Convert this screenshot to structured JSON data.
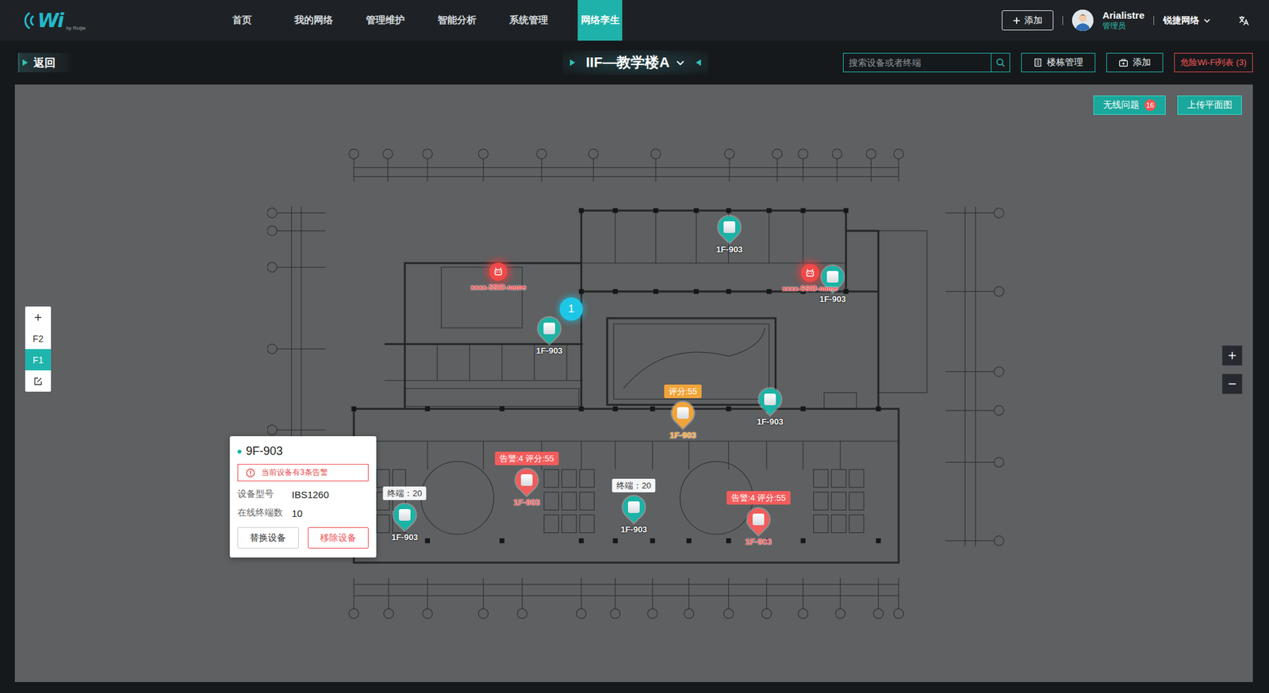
{
  "header": {
    "logo": {
      "mark": "Wi",
      "sub": "by Ruijie"
    },
    "nav": [
      {
        "label": "首页",
        "selected": false
      },
      {
        "label": "我的网络",
        "selected": false
      },
      {
        "label": "管理维护",
        "selected": false
      },
      {
        "label": "智能分析",
        "selected": false
      },
      {
        "label": "系统管理",
        "selected": false
      },
      {
        "label": "网络孪生",
        "selected": true
      }
    ],
    "add_button": {
      "label": "添加"
    },
    "user": {
      "name": "Arialistre",
      "role": "管理员"
    },
    "org": {
      "label": "锐捷网络"
    }
  },
  "toolbar": {
    "back": "返回",
    "building": "IIF—教学楼A",
    "search": {
      "placeholder": "搜索设备或者终端"
    },
    "buttons": [
      {
        "label": "楼栋管理",
        "kind": "building"
      },
      {
        "label": "添加",
        "kind": "add"
      }
    ],
    "danger_wifi": "危险Wi-Fi列表 (3)"
  },
  "map": {
    "wireless_issues": {
      "label": "无线问题",
      "count": "16"
    },
    "upload": "上传平面图",
    "floors": [
      {
        "label": "F2",
        "selected": false
      },
      {
        "label": "F1",
        "selected": true
      }
    ],
    "cluster": {
      "count": "1"
    },
    "rogue_aps": [
      {
        "label": "xxxx-SSID-name"
      },
      {
        "label": "xxxx-SSID-name"
      }
    ],
    "devices": [
      {
        "label": "1F-903",
        "status": "normal",
        "color": "#1bb3a6"
      },
      {
        "label": "1F-903",
        "status": "normal",
        "color": "#1bb3a6"
      },
      {
        "label": "1F-903",
        "status": "normal",
        "color": "#1bb3a6"
      },
      {
        "label": "1F-903",
        "status": "normal",
        "color": "#1bb3a6"
      },
      {
        "label": "1F-903",
        "status": "warning",
        "color": "#f0a43a",
        "tag": {
          "text": "评分:55",
          "kind": "score"
        }
      },
      {
        "label": "1F-903",
        "status": "alert",
        "color": "#f25c5c",
        "tag": {
          "text": "告警:4  评分:55",
          "kind": "alert"
        }
      },
      {
        "label": "1F-903",
        "status": "normal",
        "color": "#1bb3a6",
        "tag": {
          "text": "终端：20",
          "kind": "terminal"
        }
      },
      {
        "label": "1F-903",
        "status": "normal",
        "color": "#1bb3a6",
        "tag": {
          "text": "终端：20",
          "kind": "terminal"
        }
      },
      {
        "label": "1F-903",
        "status": "alert",
        "color": "#f25c5c",
        "tag": {
          "text": "告警:4  评分:55",
          "kind": "alert"
        }
      }
    ]
  },
  "popover": {
    "title": "9F-903",
    "online": true,
    "alert": "当前设备有3条告警",
    "fields": [
      {
        "label": "设备型号",
        "value": "IBS1260"
      },
      {
        "label": "在线终端数",
        "value": "10"
      }
    ],
    "buttons": [
      {
        "label": "替换设备",
        "kind": "default"
      },
      {
        "label": "移除设备",
        "kind": "danger"
      }
    ]
  }
}
